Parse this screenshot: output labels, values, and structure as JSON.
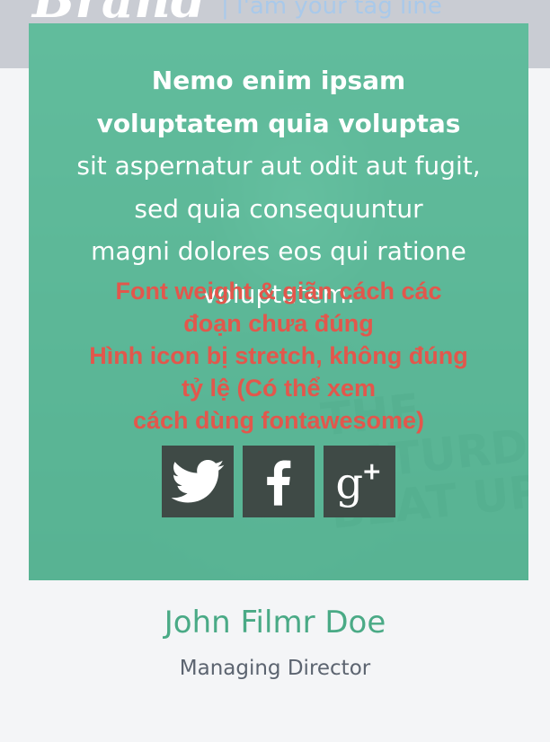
{
  "header": {
    "brand": "Brand",
    "tagline": "| I'am your tag line"
  },
  "card": {
    "shirt_text": "THE\nSATURDAY\nBEAT UP",
    "quote_lines": [
      "Nemo enim ipsam",
      "voluptatem quia voluptas",
      "sit aspernatur aut odit aut fugit,",
      "sed quia consequuntur",
      "magni dolores eos qui ratione",
      "voluptatem."
    ],
    "review_notes": [
      "Font weight & giãn cách các",
      "đoạn chưa đúng",
      "Hình icon bị stretch, không đúng",
      "tỷ lệ (Có thể xem",
      "cách dùng fontawesome)"
    ],
    "social": [
      {
        "icon": "twitter-icon",
        "label": "Twitter"
      },
      {
        "icon": "facebook-icon",
        "label": "Facebook"
      },
      {
        "icon": "google-plus-icon",
        "label": "Google+"
      }
    ],
    "overlay_color": "#52ba96",
    "note_color": "#e2574c"
  },
  "profile": {
    "name": "John Filmr Doe",
    "role": "Managing Director"
  }
}
